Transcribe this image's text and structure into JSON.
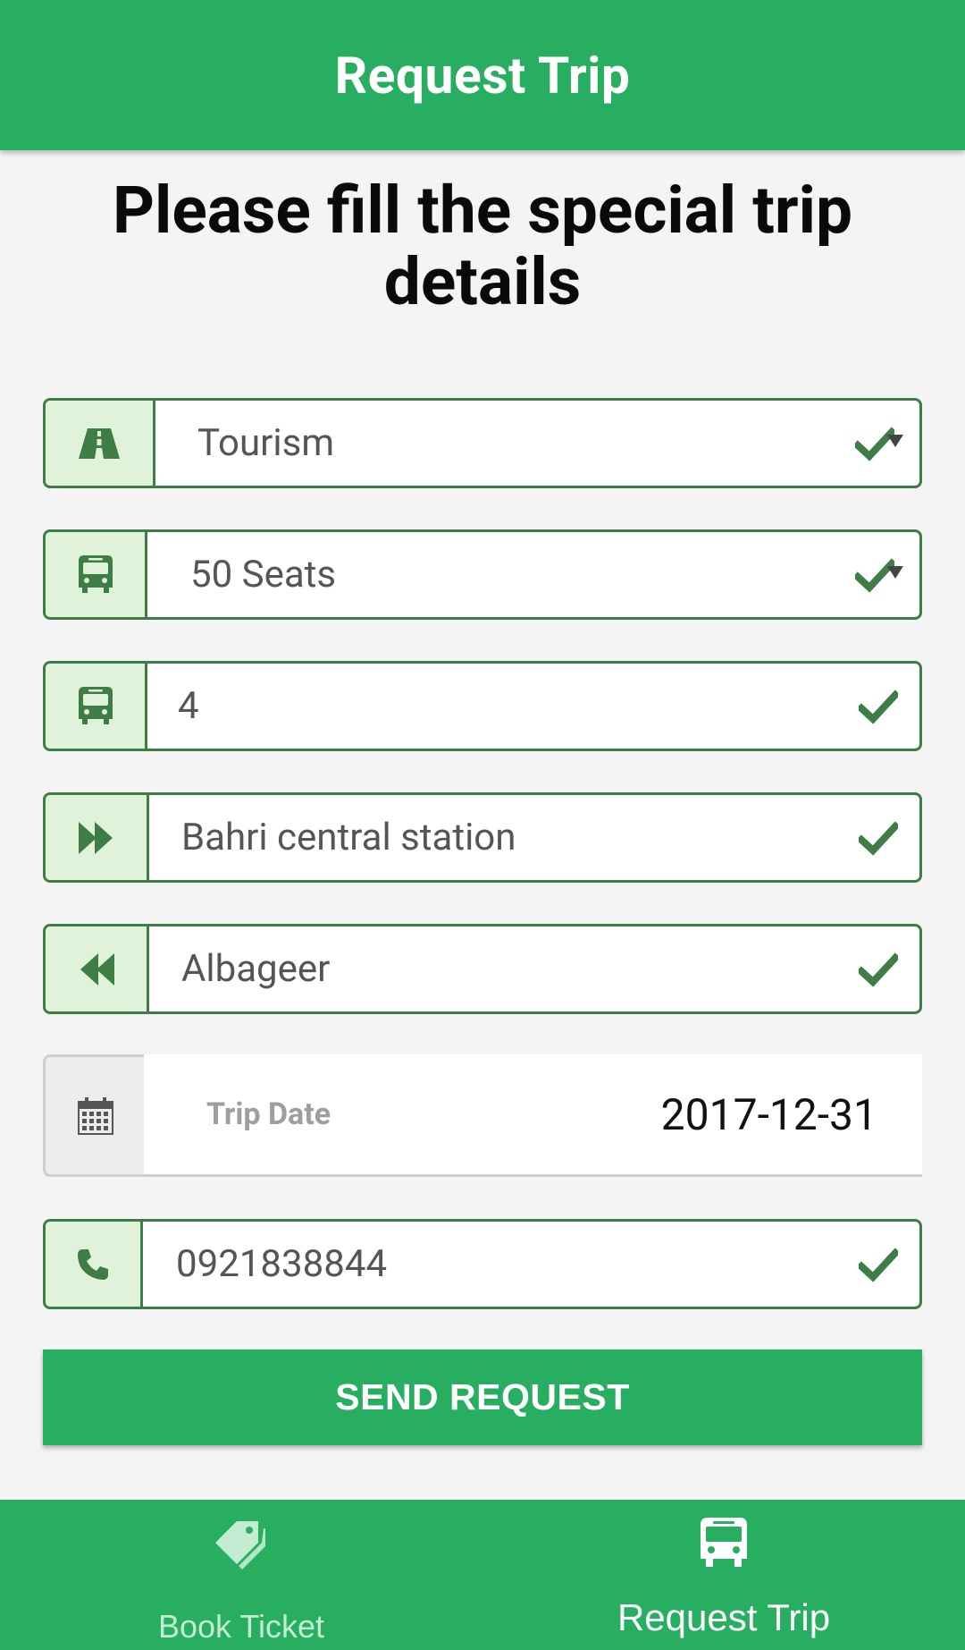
{
  "app_bar": {
    "title": "Request Trip"
  },
  "heading": "Please fill the special trip details",
  "form": {
    "trip_type": {
      "value": "Tourism",
      "icon": "road-icon"
    },
    "bus_size": {
      "value": "50 Seats",
      "icon": "bus-icon"
    },
    "bus_count": {
      "value": "4",
      "icon": "bus-icon"
    },
    "from": {
      "value": "Bahri central station",
      "icon": "forward-icon"
    },
    "to": {
      "value": "Albageer",
      "icon": "backward-icon"
    },
    "trip_date": {
      "label": "Trip Date",
      "value": "2017-12-31",
      "icon": "calendar-icon"
    },
    "phone": {
      "value": "0921838844",
      "icon": "phone-icon"
    }
  },
  "send_button": {
    "label": "SEND REQUEST"
  },
  "bottom_nav": {
    "items": [
      {
        "label": "Book Ticket",
        "icon": "tag-icon",
        "active": false
      },
      {
        "label": "Request Trip",
        "icon": "bus-icon",
        "active": true
      }
    ]
  },
  "colors": {
    "primary": "#27ae60",
    "border": "#3e7d45",
    "addon_bg": "#e0f2da",
    "check": "#3e7d45"
  }
}
